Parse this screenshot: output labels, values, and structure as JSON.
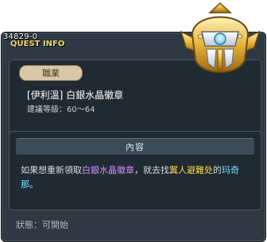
{
  "quest": {
    "id": "34829-0",
    "header": "QUEST INFO",
    "job_badge": "職業",
    "title": "[伊利溫] 白銀水晶徽章",
    "level_requirement": "建議等級：60～64",
    "section_title": "內容",
    "description": {
      "part1": "如果想重新領取",
      "item": "白銀水晶徽章",
      "part2": "，就去找",
      "npc": "翼人避難处",
      "part3": "的",
      "place": "玛奇那",
      "part4": "。"
    },
    "status": "狀態：可開始"
  },
  "icons": {
    "badge": "helmet-badge-icon"
  },
  "colors": {
    "window_bg": "#2f3943",
    "panel_bg": "#202a33",
    "header_gold": "#f0d76a",
    "item_purple": "#d18cff",
    "npc_yellow": "#ffd34d",
    "place_cyan": "#6fe3ff"
  }
}
